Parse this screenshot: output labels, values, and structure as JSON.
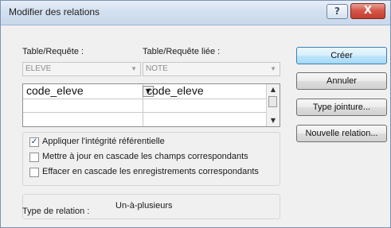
{
  "window": {
    "title": "Modifier des relations",
    "help_glyph": "?",
    "close_glyph": "X"
  },
  "labels": {
    "table": "Table/Requête :",
    "related_table": "Table/Requête liée :"
  },
  "combos": {
    "table_value": "ELEVE",
    "related_value": "NOTE"
  },
  "grid": {
    "rows": [
      {
        "left": "code_eleve",
        "right": "code_eleve"
      },
      {
        "left": "",
        "right": ""
      },
      {
        "left": "",
        "right": ""
      }
    ]
  },
  "options": {
    "enforce_integrity": {
      "label": "Appliquer l'intégrité référentielle",
      "checked": true
    },
    "cascade_update": {
      "label": "Mettre à jour en cascade les champs correspondants",
      "checked": false
    },
    "cascade_delete": {
      "label": "Effacer en cascade les enregistrements correspondants",
      "checked": false
    }
  },
  "relation_type": {
    "label": "Type de relation :",
    "value": "Un-à-plusieurs"
  },
  "buttons": {
    "create": "Créer",
    "cancel": "Annuler",
    "join_type": "Type jointure...",
    "new_relation": "Nouvelle relation..."
  },
  "icons": {
    "dropdown": "chevron-down-icon",
    "scroll_up": "arrow-up-icon",
    "scroll_down": "arrow-down-icon",
    "check": "checkmark-icon"
  }
}
